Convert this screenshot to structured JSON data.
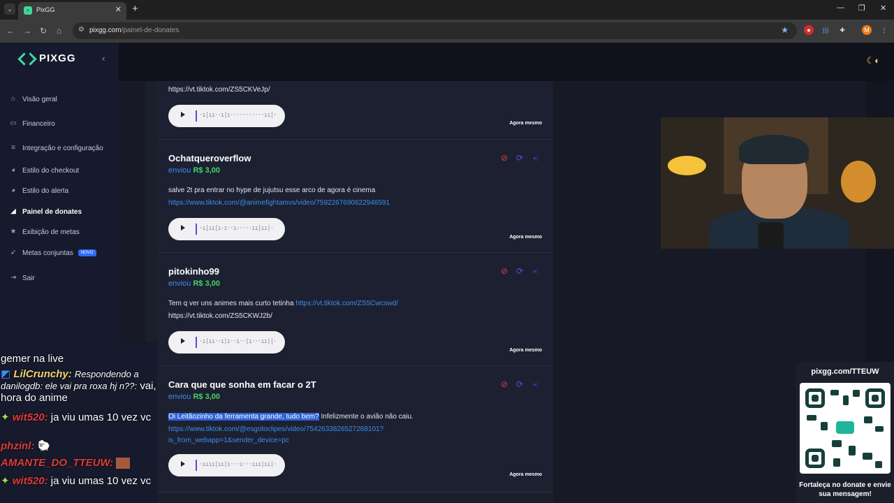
{
  "browser": {
    "tab_title": "PixGG",
    "url_host": "pixgg.com",
    "url_path": "/painel-de-donates",
    "profile_initial": "M"
  },
  "app": {
    "logo": "PIXGG",
    "nav": [
      {
        "label": "Visão geral",
        "icon": "home-icon"
      },
      {
        "label": "Financeiro",
        "icon": "wallet-icon"
      },
      {
        "label": "Integração e configuração",
        "icon": "settings-icon"
      },
      {
        "label": "Estilo do checkout",
        "icon": "palette-icon"
      },
      {
        "label": "Estilo do alerta",
        "icon": "palette-icon"
      },
      {
        "label": "Painel de donates",
        "icon": "megaphone-icon"
      },
      {
        "label": "Exibição de metas",
        "icon": "star-icon"
      },
      {
        "label": "Metas conjuntas",
        "icon": "rocket-icon",
        "badge": "NOVO"
      },
      {
        "label": "Sair",
        "icon": "logout-icon"
      }
    ]
  },
  "donations": [
    {
      "msg_tail": "https://vt.tiktok.com/ZS5CKVeJp/",
      "time": "Agora mesmo"
    },
    {
      "name": "Ochatqueroverflow",
      "sent": "enviou",
      "amount": "R$ 3,00",
      "message": "salve 2t pra entrar no hype de jujutsu esse arco de agora é cinema",
      "link": "https://www.tiktok.com/@animefightamvs/video/7592267690622946591",
      "time": "Agora mesmo"
    },
    {
      "name": "pitokinho99",
      "sent": "enviou",
      "amount": "R$ 3,00",
      "message": "Tem q ver uns animes mais curto tetinha",
      "link": "https://vt.tiktok.com/ZS5Cwcswd/",
      "extra": "https://vt.tiktok.com/ZS5CKWJ2b/",
      "time": "Agora mesmo"
    },
    {
      "name": "Cara que que sonha em facar o 2T",
      "sent": "enviou",
      "amount": "R$ 3,00",
      "highlight": "Oi Leitãozinho da ferramenta grande, tudo bem?",
      "message": " Infelizmente o avião não caiu.",
      "link_line1": "https://www.tiktok.com/@esgotoclipes/video/7542633826527268101?",
      "link_line2": "is_from_webapp=1&sender_device=pc",
      "time": "Agora mesmo"
    }
  ],
  "chat": [
    {
      "user": "",
      "text": "gemer na live"
    },
    {
      "user": "LilCrunchy:",
      "reply": "Respondendo a danilogdb: ele vai pra roxa hj n??:",
      "text": "vai, hora do anime"
    },
    {
      "user": "wit520:",
      "text": "ja viu umas 10 vez vc"
    },
    {
      "user": "phzinl:",
      "text": ""
    },
    {
      "user": "AMANTE_DO_TTEUW:",
      "text": ""
    },
    {
      "user": "wit520:",
      "text": "ja viu umas 10 vez vc"
    }
  ],
  "qr_panel": {
    "url": "pixgg.com/TTEUW",
    "cta": "Fortaleça no donate e envie sua mensagem!"
  },
  "colors": {
    "accent": "#3fd7a2",
    "link": "#3a8ef2",
    "amount": "#3fd76a",
    "block": "#e23b4a"
  }
}
